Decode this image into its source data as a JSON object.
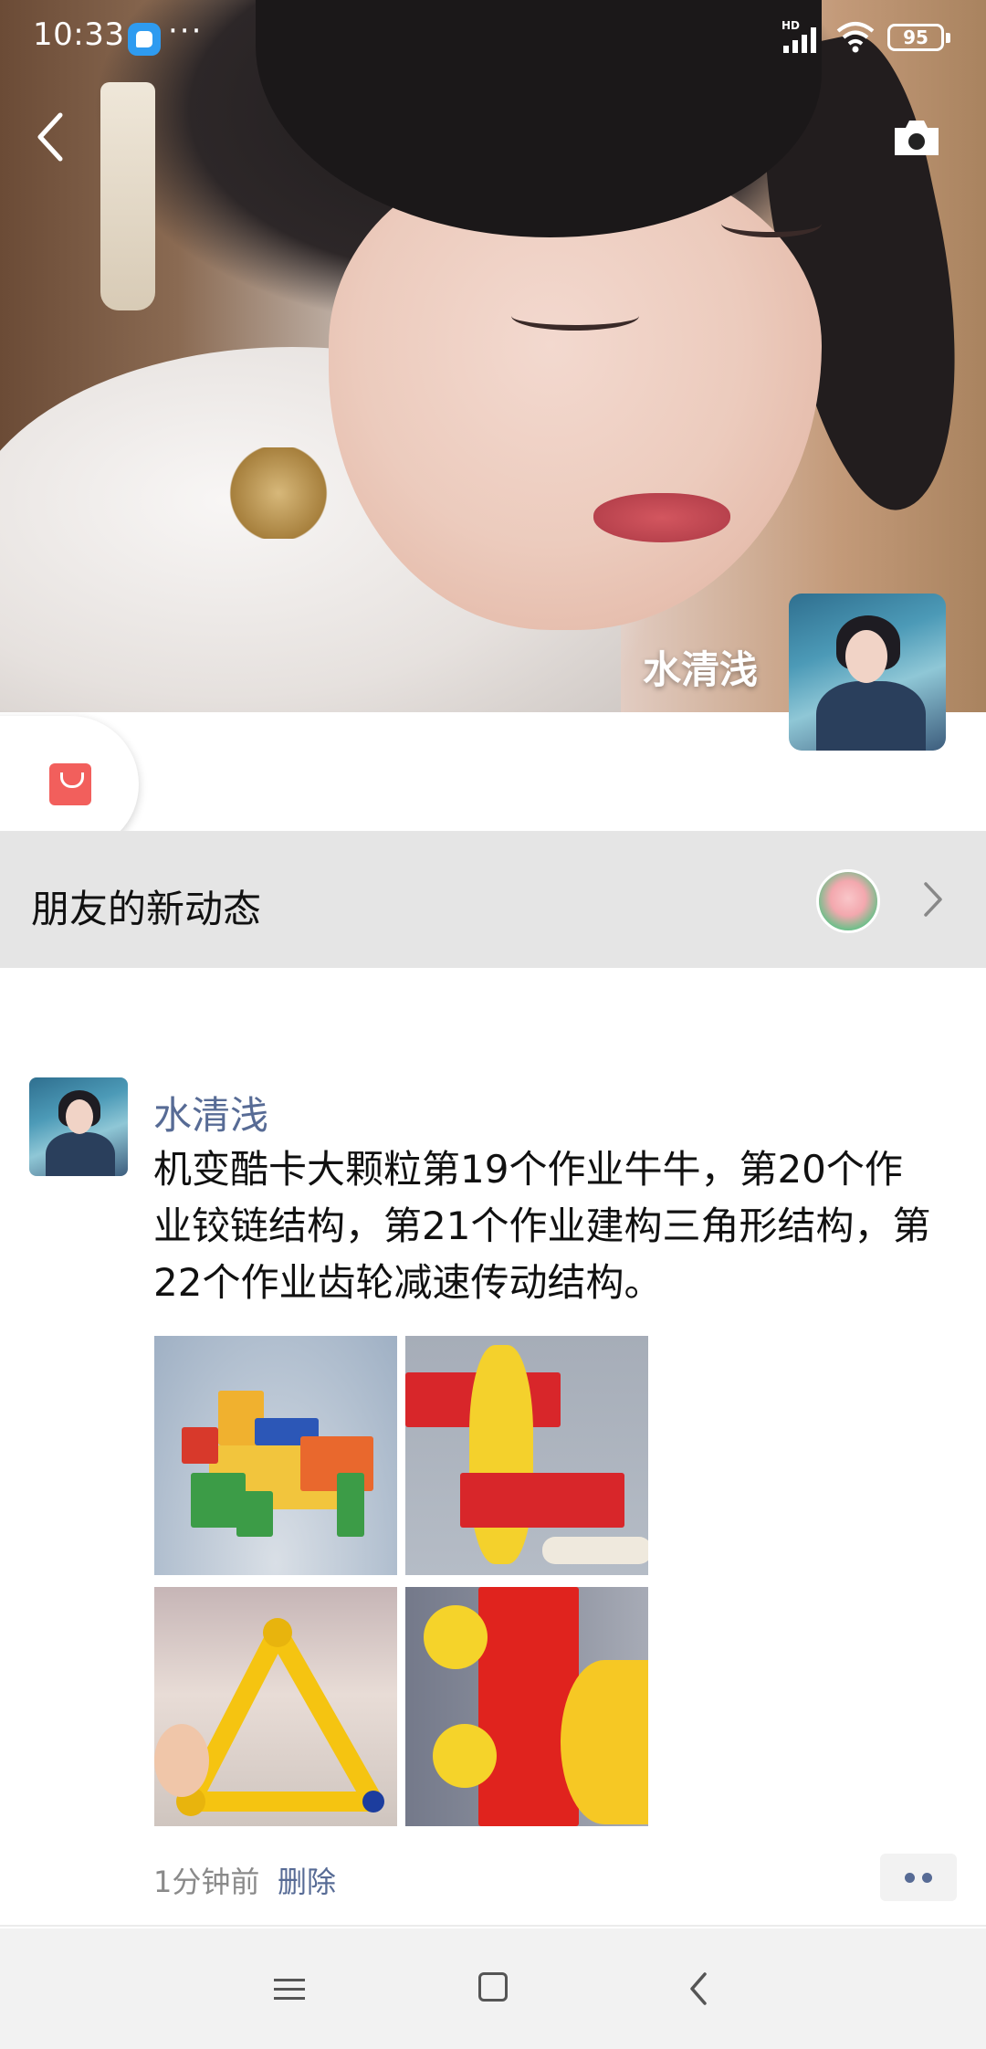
{
  "status_bar": {
    "time": "10:33",
    "network": "HD",
    "battery": "95"
  },
  "header": {
    "back_icon": "chevron-left-icon",
    "camera_icon": "camera-icon"
  },
  "profile": {
    "name": "水清浅"
  },
  "store": {
    "icon": "shopping-bag-icon",
    "color": "#f25f5c"
  },
  "friends_updates": {
    "label": "朋友的新动态",
    "chevron_icon": "chevron-right-icon"
  },
  "post": {
    "author": "水清浅",
    "text": "机变酷卡大颗粒第19个作业牛牛，第20个作业铰链结构，第21个作业建构三角形结构，第22个作业齿轮减速传动结构。",
    "photos": [
      "photo-1",
      "photo-2",
      "photo-3",
      "photo-4"
    ],
    "time": "1分钟前",
    "delete_label": "删除",
    "more_icon": "more-dots-icon"
  },
  "colors": {
    "link": "#576b95",
    "bar_bg": "#e5e5e5",
    "nav_bg": "#f2f2f2"
  },
  "nav_bar": {
    "menu_icon": "menu-icon",
    "home_icon": "home-square-icon",
    "back_icon": "back-triangle-icon"
  }
}
